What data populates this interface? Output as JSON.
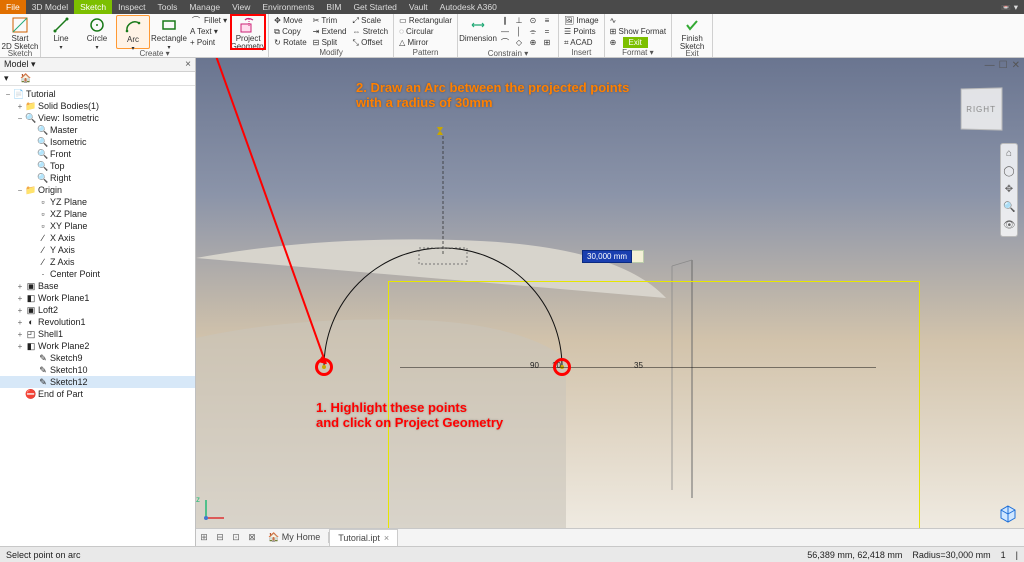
{
  "menubar": {
    "file": "File",
    "items": [
      "3D Model",
      "Sketch",
      "Inspect",
      "Tools",
      "Manage",
      "View",
      "Environments",
      "BIM",
      "Get Started",
      "Vault",
      "Autodesk A360"
    ],
    "active": "Sketch"
  },
  "ribbon": {
    "sketch_panel": {
      "title": "Sketch",
      "start": "Start\n2D Sketch"
    },
    "create": {
      "title": "Create ▾",
      "line": "Line",
      "circle": "Circle",
      "arc": "Arc",
      "rectangle": "Rectangle",
      "fillet": "Fillet ▾",
      "text": "A Text ▾",
      "point": "+ Point",
      "project": "Project\nGeometry"
    },
    "modify": {
      "title": "Modify",
      "items": [
        "✥ Move",
        "⧉ Copy",
        "↻ Rotate",
        "✂ Trim",
        "⇥ Extend",
        "⊟ Split",
        "⤢ Scale",
        "⇔ Stretch",
        "⤡ Offset"
      ]
    },
    "pattern": {
      "title": "Pattern",
      "items": [
        "▭ Rectangular",
        "◌ Circular",
        "△ Mirror"
      ]
    },
    "constrain": {
      "title": "Constrain ▾",
      "dimension": "Dimension"
    },
    "insert": {
      "title": "Insert",
      "items": [
        "🖼 Image",
        "☰ Points",
        "⌗ ACAD"
      ]
    },
    "format": {
      "title": "Format ▾",
      "items": [
        "∿",
        "⊞ Show Format",
        "⊕"
      ]
    },
    "exit": {
      "title": "Exit",
      "finish": "Finish\nSketch",
      "btn": "Exit"
    }
  },
  "browser": {
    "title": "Model ▾",
    "nodes": [
      {
        "d": 0,
        "tw": "−",
        "ic": "📄",
        "t": "Tutorial"
      },
      {
        "d": 1,
        "tw": "+",
        "ic": "📁",
        "t": "Solid Bodies(1)"
      },
      {
        "d": 1,
        "tw": "−",
        "ic": "🔍",
        "t": "View: Isometric"
      },
      {
        "d": 2,
        "tw": "",
        "ic": "🔍",
        "t": "Master"
      },
      {
        "d": 2,
        "tw": "",
        "ic": "🔍",
        "t": "Isometric"
      },
      {
        "d": 2,
        "tw": "",
        "ic": "🔍",
        "t": "Front"
      },
      {
        "d": 2,
        "tw": "",
        "ic": "🔍",
        "t": "Top"
      },
      {
        "d": 2,
        "tw": "",
        "ic": "🔍",
        "t": "Right"
      },
      {
        "d": 1,
        "tw": "−",
        "ic": "📁",
        "t": "Origin"
      },
      {
        "d": 2,
        "tw": "",
        "ic": "▫",
        "t": "YZ Plane"
      },
      {
        "d": 2,
        "tw": "",
        "ic": "▫",
        "t": "XZ Plane"
      },
      {
        "d": 2,
        "tw": "",
        "ic": "▫",
        "t": "XY Plane"
      },
      {
        "d": 2,
        "tw": "",
        "ic": "∕",
        "t": "X Axis"
      },
      {
        "d": 2,
        "tw": "",
        "ic": "∕",
        "t": "Y Axis"
      },
      {
        "d": 2,
        "tw": "",
        "ic": "∕",
        "t": "Z Axis"
      },
      {
        "d": 2,
        "tw": "",
        "ic": "·",
        "t": "Center Point"
      },
      {
        "d": 1,
        "tw": "+",
        "ic": "▣",
        "t": "Base"
      },
      {
        "d": 1,
        "tw": "+",
        "ic": "◧",
        "t": "Work Plane1"
      },
      {
        "d": 1,
        "tw": "+",
        "ic": "▣",
        "t": "Loft2"
      },
      {
        "d": 1,
        "tw": "+",
        "ic": "◐",
        "t": "Revolution1"
      },
      {
        "d": 1,
        "tw": "+",
        "ic": "◰",
        "t": "Shell1"
      },
      {
        "d": 1,
        "tw": "+",
        "ic": "◧",
        "t": "Work Plane2"
      },
      {
        "d": 2,
        "tw": "",
        "ic": "✎",
        "t": "Sketch9"
      },
      {
        "d": 2,
        "tw": "",
        "ic": "✎",
        "t": "Sketch10"
      },
      {
        "d": 2,
        "tw": "",
        "ic": "✎",
        "t": "Sketch12",
        "sel": true
      },
      {
        "d": 1,
        "tw": "",
        "ic": "⛔",
        "t": "End of Part"
      }
    ]
  },
  "canvas": {
    "viewcube": "RIGHT",
    "dim_value": "30,000 mm",
    "axis_labels": [
      "90",
      "10",
      "35"
    ],
    "annot2": "2. Draw an Arc between the projected points\nwith a radius of 30mm",
    "annot1": "1. Highlight these points\nand click on Project Geometry",
    "triad_z": "z"
  },
  "tabs": {
    "home": "My Home",
    "doc": "Tutorial.ipt"
  },
  "status": {
    "prompt": "Select point on arc",
    "coords": "56,389 mm, 62,418 mm",
    "radius": "Radius=30,000 mm",
    "count": "1"
  }
}
